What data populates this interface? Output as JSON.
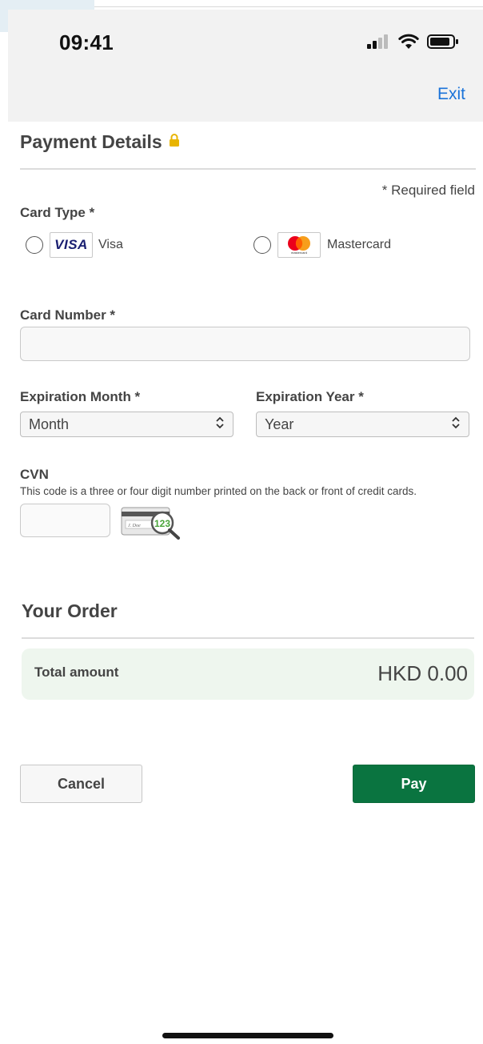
{
  "status_bar": {
    "time": "09:41",
    "icons": [
      "signal-icon",
      "wifi-icon",
      "battery-icon"
    ]
  },
  "header": {
    "exit_label": "Exit"
  },
  "payment": {
    "title": "Payment Details",
    "required_note": "* Required field",
    "card_type_label": "Card Type *",
    "card_types": [
      {
        "logo_text": "VISA",
        "label": "Visa",
        "selected": false
      },
      {
        "logo_text": "mastercard",
        "label": "Mastercard",
        "selected": false
      }
    ],
    "card_number_label": "Card Number *",
    "card_number_value": "",
    "exp_month_label": "Expiration Month *",
    "exp_month_value": "Month",
    "exp_year_label": "Expiration Year *",
    "exp_year_value": "Year",
    "cvn_label": "CVN",
    "cvn_help": "This code is a three or four digit number printed on the back or front of credit cards.",
    "cvn_value": "",
    "cvn_hint_digits": "123"
  },
  "order": {
    "title": "Your Order",
    "total_label": "Total amount",
    "total_value": "HKD 0.00"
  },
  "actions": {
    "cancel_label": "Cancel",
    "pay_label": "Pay"
  },
  "colors": {
    "accent_link": "#1a73d9",
    "pay_button": "#0a7440",
    "total_bg": "#eef6ee",
    "lock": "#e8b400"
  }
}
